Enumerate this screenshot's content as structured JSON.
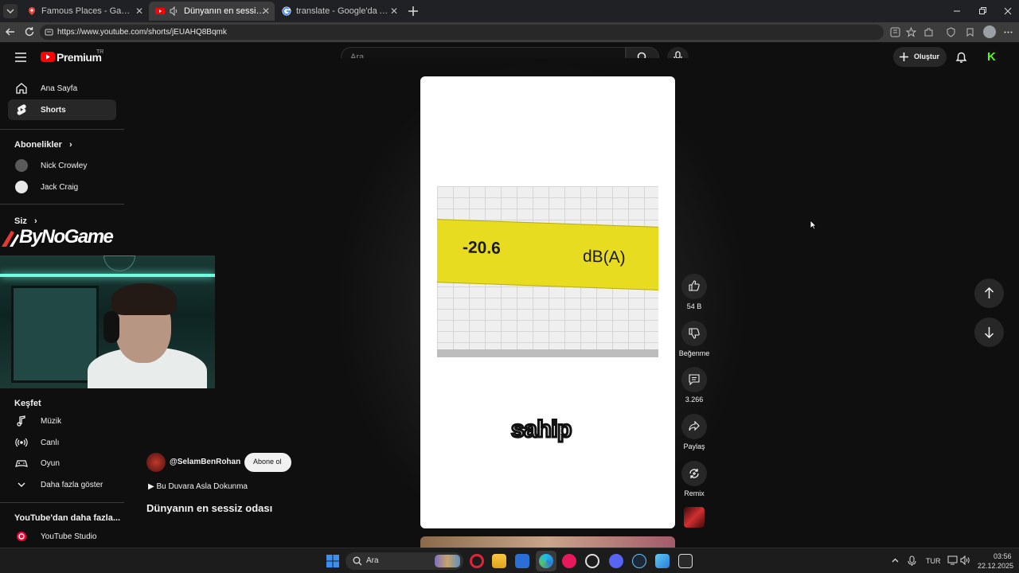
{
  "browser": {
    "tabs": [
      {
        "title": "Famous Places - Game - GeoGuessr",
        "icon": "map-pin-icon"
      },
      {
        "title": "Dünyanın en sessiz odası - YouTube",
        "icon": "youtube-icon"
      },
      {
        "title": "translate - Google'da Ara",
        "icon": "google-icon"
      }
    ],
    "url": "https://www.youtube.com/shorts/jEUAHQ8Bqmk"
  },
  "youtube": {
    "logo": "Premium",
    "region": "TR",
    "search_placeholder": "Ara",
    "create_label": "Oluştur",
    "avatar_letter": "K",
    "nav": [
      {
        "label": "Ana Sayfa",
        "icon": "home-icon"
      },
      {
        "label": "Shorts",
        "icon": "shorts-icon"
      }
    ],
    "subscriptions_title": "Abonelikler",
    "subscriptions": [
      {
        "label": "Nick Crowley"
      },
      {
        "label": "Jack Craig"
      }
    ],
    "you_title": "Siz",
    "explore_title": "Keşfet",
    "explore": [
      {
        "label": "Müzik",
        "icon": "music-icon"
      },
      {
        "label": "Canlı",
        "icon": "live-icon"
      },
      {
        "label": "Oyun",
        "icon": "gamepad-icon"
      },
      {
        "label": "Daha fazla göster",
        "icon": "chevron-down-icon"
      }
    ],
    "more_title": "YouTube'dan daha fazla...",
    "studio_label": "YouTube Studio",
    "overlay_brand": "ByNoGame",
    "short": {
      "meter_value": "-20.6",
      "meter_unit": "dB(A)",
      "caption": "sahip",
      "channel": "@SelamBenRohan",
      "subscribe": "Abone ol",
      "music": "▶ Bu Duvara Asla Dokunma",
      "title": "Dünyanın en sessiz odası"
    },
    "actions": {
      "likes": "54 B",
      "dislike": "Beğenme",
      "comments": "3.266",
      "share": "Paylaş",
      "remix": "Remix"
    }
  },
  "taskbar": {
    "search": "Ara",
    "lang": "TUR",
    "time": "03:56",
    "date": "22.12.2025"
  }
}
